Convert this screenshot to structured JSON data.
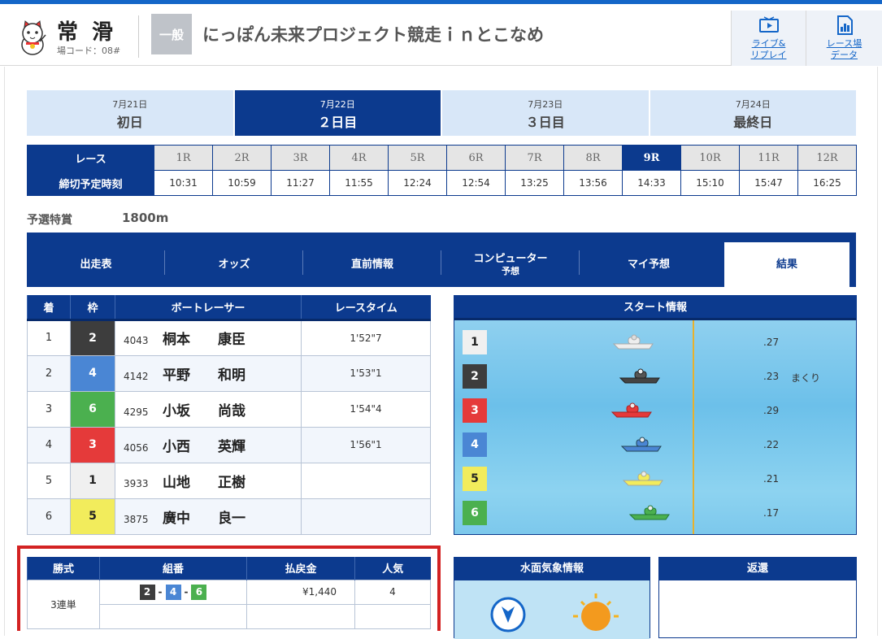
{
  "header": {
    "stadium": "常 滑",
    "code": "場コード：08#",
    "grade": "一般",
    "title": "にっぽん未来プロジェクト競走ｉｎとこなめ",
    "link1": [
      "ライブ&",
      "リプレイ"
    ],
    "link2": [
      "レース場",
      "データ"
    ]
  },
  "days": [
    {
      "date": "7月21日",
      "name": "初日"
    },
    {
      "date": "7月22日",
      "name": "２日目",
      "active": true
    },
    {
      "date": "7月23日",
      "name": "３日目"
    },
    {
      "date": "7月24日",
      "name": "最終日"
    }
  ],
  "races": {
    "header_race": "レース",
    "header_time": "締切予定時刻",
    "labels": [
      "1R",
      "2R",
      "3R",
      "4R",
      "5R",
      "6R",
      "7R",
      "8R",
      "9R",
      "10R",
      "11R",
      "12R"
    ],
    "times": [
      "10:31",
      "10:59",
      "11:27",
      "11:55",
      "12:24",
      "12:54",
      "13:25",
      "13:56",
      "14:33",
      "15:10",
      "15:47",
      "16:25"
    ],
    "active_index": 8
  },
  "race_info": {
    "type": "予選特賞",
    "distance": "1800m"
  },
  "nav": {
    "items": [
      "出走表",
      "オッズ",
      "直前情報",
      "コンピューター",
      "マイ予想",
      "結果"
    ],
    "sub": "予想"
  },
  "results": {
    "headers": [
      "着",
      "枠",
      "ボートレーサー",
      "レースタイム"
    ],
    "rows": [
      {
        "place": "1",
        "frame": "2",
        "id": "4043",
        "name": "桐本　　康臣",
        "time": "1'52\"7"
      },
      {
        "place": "2",
        "frame": "4",
        "id": "4142",
        "name": "平野　　和明",
        "time": "1'53\"1"
      },
      {
        "place": "3",
        "frame": "6",
        "id": "4295",
        "name": "小坂　　尚哉",
        "time": "1'54\"4"
      },
      {
        "place": "4",
        "frame": "3",
        "id": "4056",
        "name": "小西　　英輝",
        "time": "1'56\"1"
      },
      {
        "place": "5",
        "frame": "1",
        "id": "3933",
        "name": "山地　　正樹",
        "time": ""
      },
      {
        "place": "6",
        "frame": "5",
        "id": "3875",
        "name": "廣中　　良一",
        "time": ""
      }
    ]
  },
  "start_info": {
    "title": "スタート情報",
    "rows": [
      {
        "course": "1",
        "st": ".27",
        "tactic": ""
      },
      {
        "course": "2",
        "st": ".23",
        "tactic": "まくり"
      },
      {
        "course": "3",
        "st": ".29",
        "tactic": ""
      },
      {
        "course": "4",
        "st": ".22",
        "tactic": ""
      },
      {
        "course": "5",
        "st": ".21",
        "tactic": ""
      },
      {
        "course": "6",
        "st": ".17",
        "tactic": ""
      }
    ]
  },
  "payout": {
    "headers": [
      "勝式",
      "組番",
      "払戻金",
      "人気"
    ],
    "type": "3連単",
    "combo": [
      "2",
      "4",
      "6"
    ],
    "sep": "-",
    "amount": "¥1,440",
    "popularity": "4"
  },
  "weather": {
    "title": "水面気象情報"
  },
  "refund": {
    "title": "返還"
  },
  "colors": {
    "navy": "#0c3a8e",
    "highlight": "#d32222",
    "f1": "#f0f0f0",
    "f2": "#3d3d3d",
    "f3": "#e53a3a",
    "f4": "#4a86d4",
    "f5": "#f2ec5c",
    "f6": "#4bb04f"
  }
}
